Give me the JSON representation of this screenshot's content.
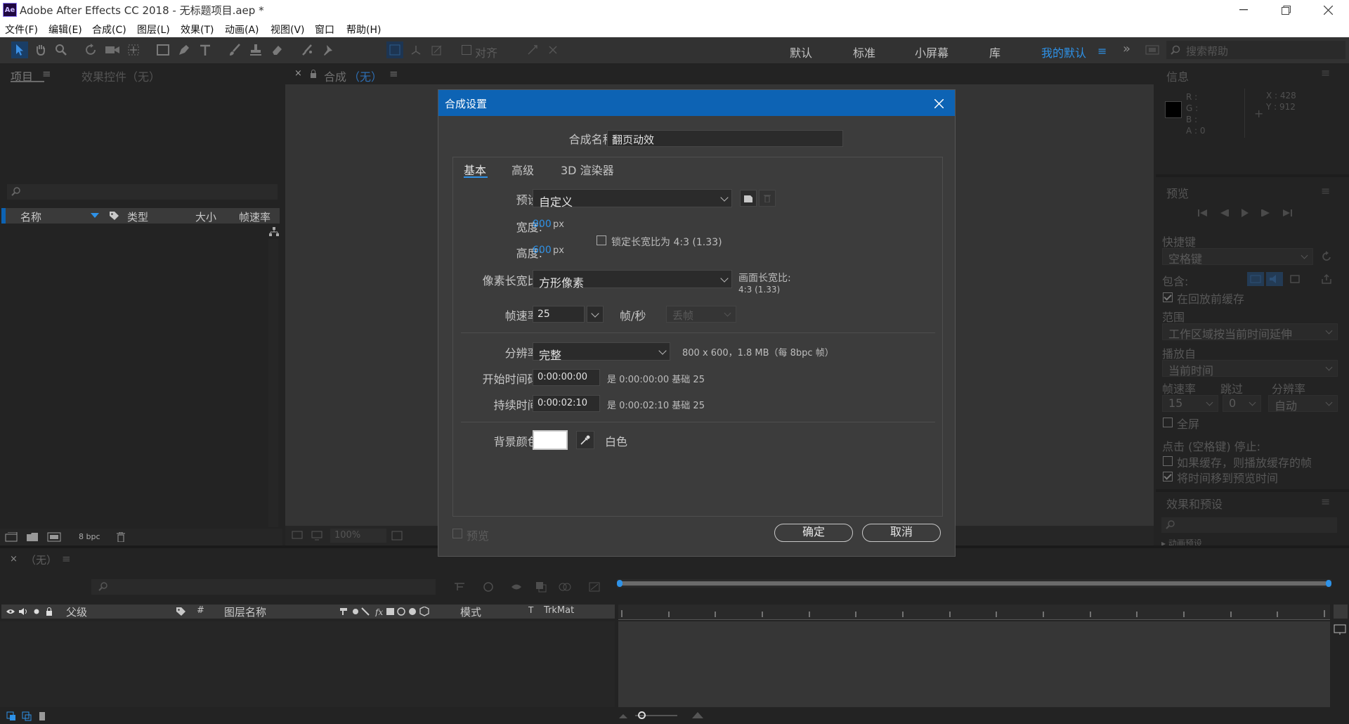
{
  "window": {
    "title": "Adobe After Effects CC 2018 - 无标题项目.aep *",
    "app_icon": "Ae"
  },
  "menu": [
    "文件(F)",
    "编辑(E)",
    "合成(C)",
    "图层(L)",
    "效果(T)",
    "动画(A)",
    "视图(V)",
    "窗口",
    "帮助(H)"
  ],
  "toolbar": {
    "align_label": "对齐",
    "workspaces": [
      "默认",
      "标准",
      "小屏幕",
      "库",
      "我的默认"
    ],
    "active_workspace": "我的默认",
    "search_placeholder": "搜索帮助"
  },
  "project_panel": {
    "tab_project": "项目",
    "tab_effects": "效果控件（无）",
    "columns": [
      "名称",
      "类型",
      "大小",
      "帧速率"
    ],
    "bpc": "8 bpc"
  },
  "comp_panel": {
    "tab_label": "合成",
    "tab_value": "（无）",
    "zoom": "100%"
  },
  "dialog": {
    "title": "合成设置",
    "comp_name_label": "合成名称:",
    "comp_name": "翻页动效",
    "tabs": [
      "基本",
      "高级",
      "3D 渲染器"
    ],
    "preset_label": "预设:",
    "preset": "自定义",
    "width_label": "宽度:",
    "width": "800",
    "height_label": "高度:",
    "height": "600",
    "unit_px": "px",
    "lock_label": "锁定长宽比为 4:3 (1.33)",
    "pixel_aspect_label": "像素长宽比:",
    "pixel_aspect": "方形像素",
    "frame_aspect_label": "画面长宽比:",
    "frame_aspect": "4:3 (1.33)",
    "fps_label": "帧速率:",
    "fps": "25",
    "fps_unit": "帧/秒",
    "drop_frame": "丢帧",
    "resolution_label": "分辨率:",
    "resolution": "完整",
    "resolution_info": "800 x 600，1.8 MB（每 8bpc 帧）",
    "start_label": "开始时间码:",
    "start": "0:00:00:00",
    "start_info": "是 0:00:00:00  基础 25",
    "duration_label": "持续时间:",
    "duration": "0:00:02:10",
    "duration_info": "是 0:00:02:10  基础 25",
    "bg_label": "背景颜色:",
    "bg_color_name": "白色",
    "bg_color": "#ffffff",
    "preview_label": "预览",
    "ok": "确定",
    "cancel": "取消"
  },
  "info_panel": {
    "title": "信息",
    "r": "R :",
    "g": "G :",
    "b": "B :",
    "a": "A : 0",
    "x": "X : 428",
    "y": "Y : 912"
  },
  "preview_panel": {
    "title": "预览",
    "shortcut_label": "快捷键",
    "shortcut": "空格键",
    "include_label": "包含:",
    "cache_before": "在回放前缓存",
    "range_label": "范围",
    "range": "工作区域按当前时间延伸",
    "play_from_label": "播放自",
    "play_from": "当前时间",
    "fps_label": "帧速率",
    "skip_label": "跳过",
    "res_label": "分辨率",
    "fps": "15",
    "skip": "0",
    "res": "自动",
    "fullscreen": "全屏",
    "stop_label": "点击 (空格键) 停止:",
    "opt1": "如果缓存，则播放缓存的帧",
    "opt2": "将时间移到预览时间"
  },
  "effects_panel": {
    "title": "效果和预设",
    "item": "▸ 动画预设"
  },
  "timeline": {
    "tab": "（无）",
    "columns": [
      "父级",
      "#",
      "图层名称",
      "模式",
      "T",
      "TrkMat"
    ]
  }
}
